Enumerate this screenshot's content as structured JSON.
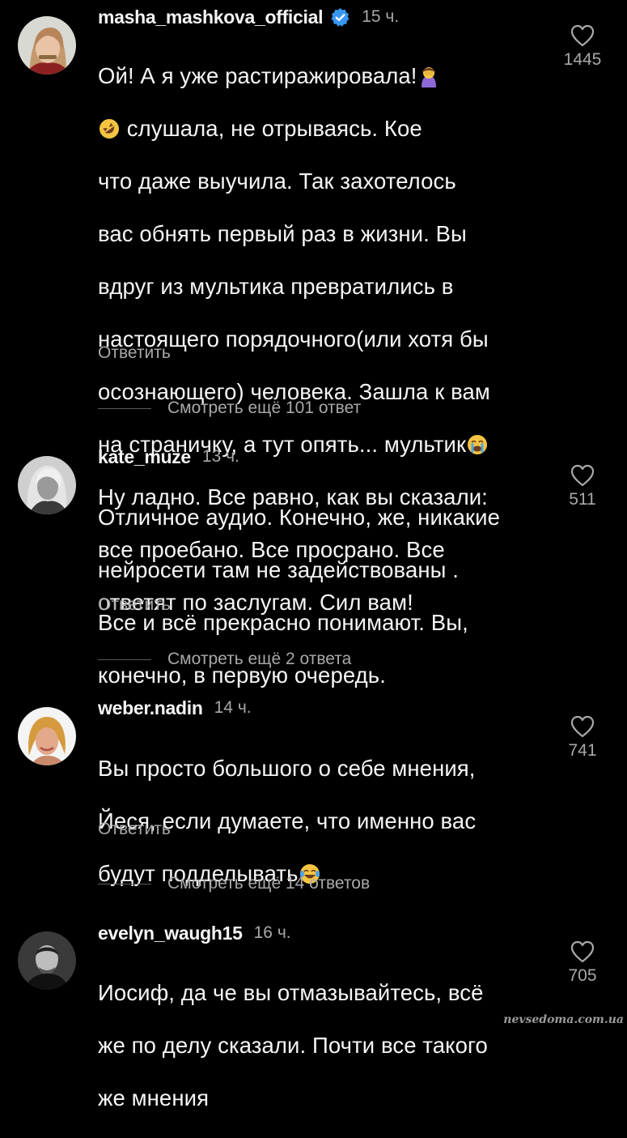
{
  "comments": [
    {
      "username": "masha_mashkova_official",
      "verified": true,
      "time": "15 ч.",
      "likes": "1445",
      "reply_label": "Ответить",
      "lines": [
        "Ой! А я уже растиражировала!",
        "слушала, не отрываясь. Кое",
        "что даже выучила. Так захотелось",
        "вас обнять первый раз в жизни. Вы",
        "вдруг из мультика превратились в",
        "настоящего порядочного(или хотя бы",
        "осознающего) человека. Зашла к вам",
        "на страничку, а тут опять... мультик",
        "Ну ладно. Все равно, как вы сказали:",
        "все проебано. Все просрано. Все",
        "ответят по заслугам. Сил вам!"
      ],
      "emojis": [
        "woman-facepalming-emoji",
        "rolling-on-floor-laughing-emoji",
        "loudly-crying-emoji"
      ],
      "more_replies": "Смотреть ещё 101 ответ"
    },
    {
      "username": "kate_muze",
      "verified": false,
      "time": "13 ч.",
      "likes": "511",
      "reply_label": "Ответить",
      "lines": [
        "Отличное аудио. Конечно, же, никакие",
        "нейросети там не задействованы .",
        "Все и всё прекрасно понимают. Вы,",
        "конечно, в первую очередь."
      ],
      "more_replies": "Смотреть ещё 2 ответа"
    },
    {
      "username": "weber.nadin",
      "verified": false,
      "time": "14 ч.",
      "likes": "741",
      "reply_label": "Ответить",
      "lines": [
        "Вы просто большого о себе мнения,",
        "Йеся, если думаете, что именно вас",
        "будут подделывать"
      ],
      "emojis": [
        "face-with-tears-of-joy-emoji"
      ],
      "more_replies": "Смотреть ещё 14 ответов"
    },
    {
      "username": "evelyn_waugh15",
      "verified": false,
      "time": "16 ч.",
      "likes": "705",
      "lines": [
        "Иосиф, да че вы отмазывайтесь, всё",
        "же по делу сказали. Почти все такого",
        "же мнения"
      ]
    }
  ],
  "watermark": "nevsedoma.com.ua",
  "colors": {
    "background": "#000000",
    "text": "#f5f5f5",
    "secondary_text": "#a8a8a8",
    "verified_badge": "#3897f0"
  }
}
